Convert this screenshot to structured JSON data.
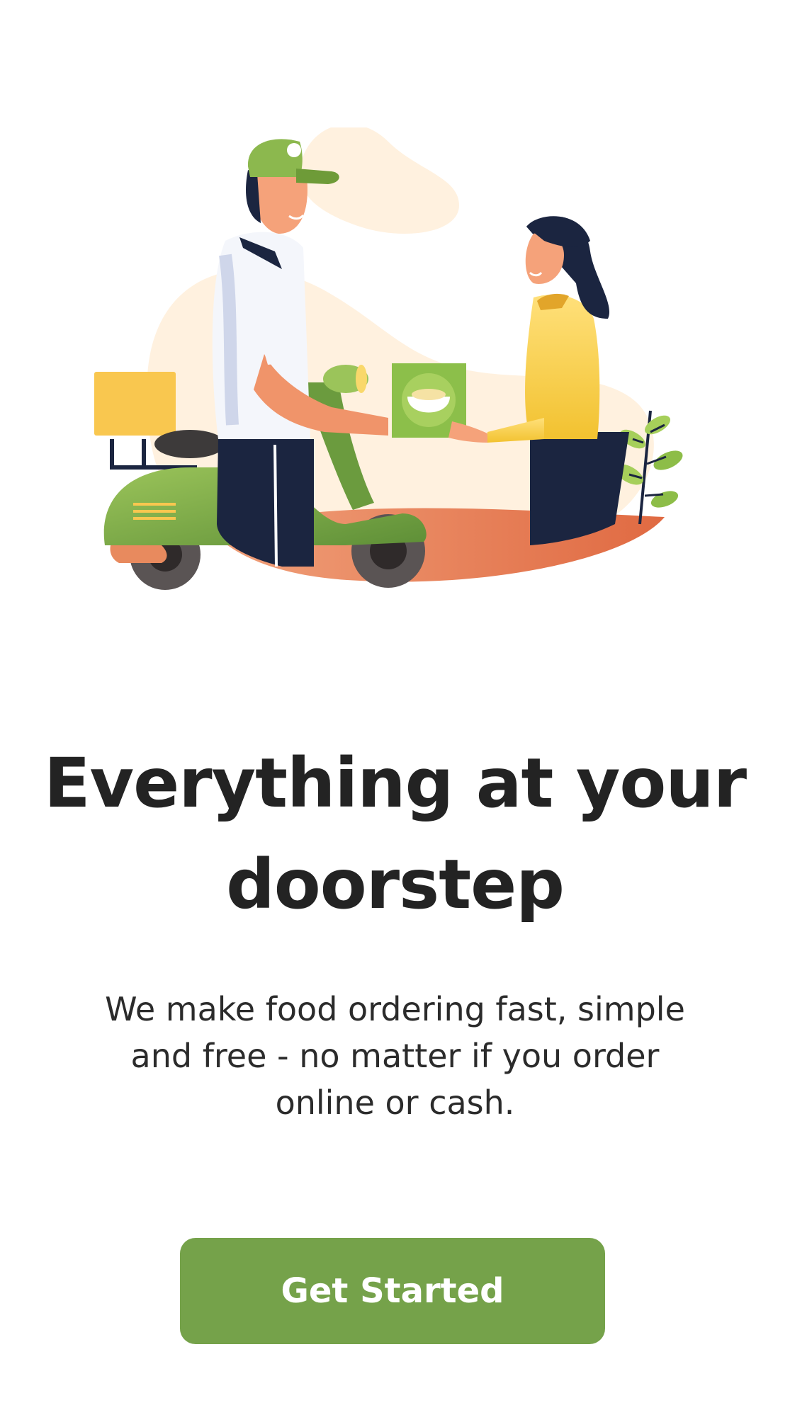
{
  "onboarding": {
    "headline": "Everything at your doorstep",
    "subtitle": "We make food ordering fast, simple and free - no matter if you order online or cash.",
    "cta_label": "Get Started"
  },
  "illustration": {
    "subject": "food-delivery-illustration"
  },
  "colors": {
    "primary": "#75a24a",
    "text": "#232323",
    "background": "#ffffff"
  }
}
